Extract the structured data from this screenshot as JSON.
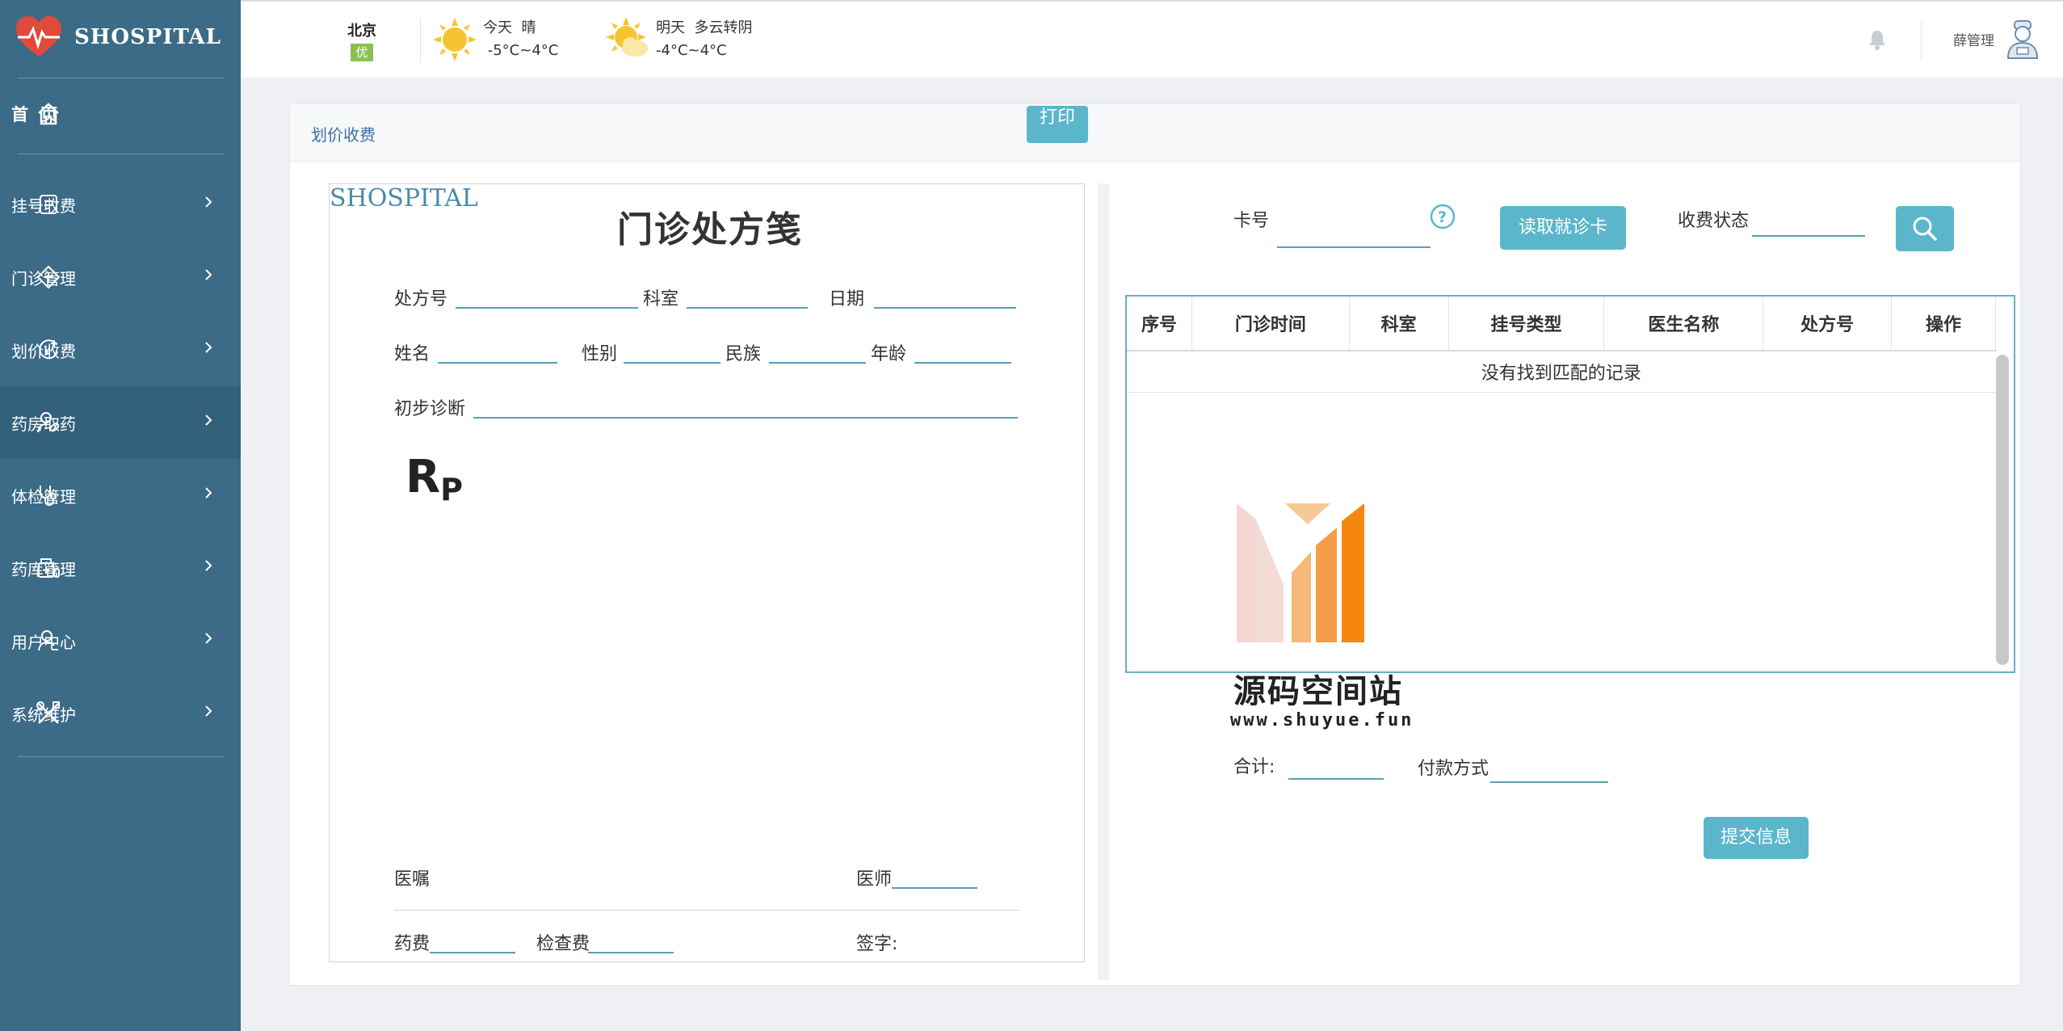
{
  "app": {
    "name": "SHOSPITAL"
  },
  "sidebar": {
    "home_label": "首 页",
    "items": [
      {
        "label": "挂号收费",
        "icon": "register-icon"
      },
      {
        "label": "门诊管理",
        "icon": "clinic-icon"
      },
      {
        "label": "划价收费",
        "icon": "yen-icon"
      },
      {
        "label": "药房取药",
        "icon": "pharmacy-user-icon",
        "active": true
      },
      {
        "label": "体检管理",
        "icon": "stethoscope-icon"
      },
      {
        "label": "药库管理",
        "icon": "medicine-store-icon"
      },
      {
        "label": "用户中心",
        "icon": "user-icon"
      },
      {
        "label": "系统维护",
        "icon": "tools-icon"
      }
    ]
  },
  "topbar": {
    "city": "北京",
    "aqi": "优",
    "today": {
      "label": "今天",
      "condition": "晴",
      "temp": "-5°C~4°C"
    },
    "tomorrow": {
      "label": "明天",
      "condition": "多云转阴",
      "temp": "-4°C~4°C"
    },
    "user": "薛管理"
  },
  "panel": {
    "title": "划价收费",
    "print_label": "打印"
  },
  "prescription": {
    "brand": "SHOSPITAL",
    "title": "门诊处方笺",
    "fields": {
      "rx_no": "处方号",
      "department": "科室",
      "date": "日期",
      "name": "姓名",
      "gender": "性别",
      "ethnicity": "民族",
      "age": "年龄",
      "diagnosis": "初步诊断",
      "advice": "医嘱",
      "doctor": "医师",
      "drug_fee": "药费",
      "exam_fee": "检查费",
      "signature": "签字:"
    }
  },
  "search": {
    "card_label": "卡号",
    "read_card_button": "读取就诊卡",
    "status_label": "收费状态"
  },
  "table": {
    "columns": [
      "序号",
      "门诊时间",
      "科室",
      "挂号类型",
      "医生名称",
      "处方号",
      "操作"
    ],
    "empty_text": "没有找到匹配的记录"
  },
  "summary": {
    "total_label": "合计:",
    "payment_label": "付款方式",
    "submit_button": "提交信息"
  },
  "watermark": {
    "title": "源码空间站",
    "url": "www.shuyue.fun"
  }
}
